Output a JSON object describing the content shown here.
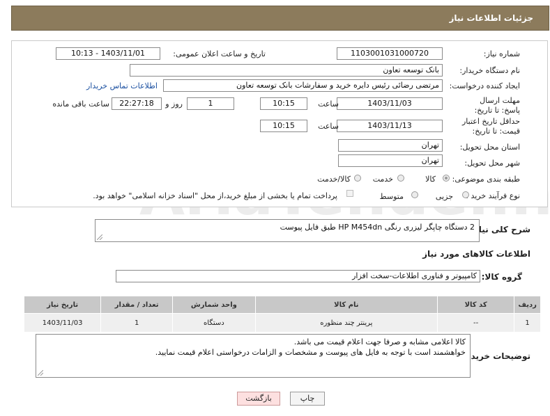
{
  "header": {
    "title": "جزئیات اطلاعات نیاز"
  },
  "fields": {
    "need_number_label": "شماره نیاز:",
    "need_number": "1103001031000720",
    "announce_label": "تاریخ و ساعت اعلان عمومی:",
    "announce_value": "1403/11/01 - 10:13",
    "buyer_label": "نام دستگاه خریدار:",
    "buyer_value": "بانک توسعه تعاون",
    "creator_label": "ایجاد کننده درخواست:",
    "creator_value": "مرتضی رضائی رئیس دایره خرید و سفارشات بانک توسعه تعاون",
    "contact_link": "اطلاعات تماس خریدار",
    "deadline_label": "مهلت ارسال پاسخ: تا تاریخ:",
    "deadline_date": "1403/11/03",
    "time_label": "ساعت",
    "deadline_time": "10:15",
    "days_value": "1",
    "days_label": "روز و",
    "remaining_time": "22:27:18",
    "remaining_label": "ساعت باقی مانده",
    "validity_label": "حداقل تاریخ اعتبار قیمت: تا تاریخ:",
    "validity_date": "1403/11/13",
    "validity_time": "10:15",
    "province_label": "استان محل تحویل:",
    "province_value": "تهران",
    "city_label": "شهر محل تحویل:",
    "city_value": "تهران",
    "category_label": "طبقه بندی موضوعی:",
    "cat_opt1": "کالا",
    "cat_opt2": "خدمت",
    "cat_opt3": "کالا/خدمت",
    "process_label": "نوع فرآیند خرید :",
    "proc_opt1": "جزیی",
    "proc_opt2": "متوسط",
    "payment_note": "پرداخت تمام یا بخشی از مبلغ خرید،از محل \"اسناد خزانه اسلامی\" خواهد بود."
  },
  "description": {
    "label": "شرح کلی نیاز:",
    "text": "2 دستگاه چاپگر لیزری رنگی HP M454dn طبق فایل پیوست"
  },
  "goods": {
    "section_title": "اطلاعات کالاهای مورد نیاز",
    "group_label": "گروه کالا:",
    "group_value": "کامپیوتر و فناوری اطلاعات-سخت افزار",
    "columns": [
      "ردیف",
      "کد کالا",
      "نام کالا",
      "واحد شمارش",
      "تعداد / مقدار",
      "تاریخ نیاز"
    ],
    "rows": [
      [
        "1",
        "--",
        "پرینتر چند منظوره",
        "دستگاه",
        "1",
        "1403/11/03"
      ]
    ]
  },
  "buyer_notes": {
    "label": "توضیحات خریدار:",
    "line1": "کالا اعلامی مشابه و صرفا جهت اعلام قیمت می باشد.",
    "line2": "خواهشمند است با توجه به فایل های پیوست و مشخصات و الزامات درخواستی اعلام قیمت نمایید."
  },
  "buttons": {
    "print": "چاپ",
    "back": "بازگشت"
  },
  "watermark": "AriaTender.neT"
}
